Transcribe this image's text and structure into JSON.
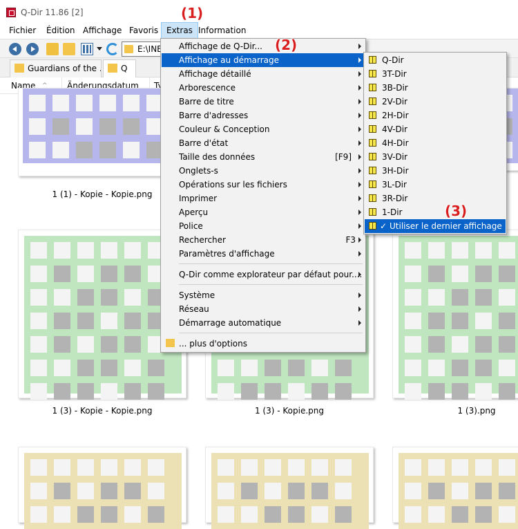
{
  "window": {
    "title": "Q-Dir 11.86 [2]"
  },
  "menubar": {
    "items": [
      "Fichier",
      "Édition",
      "Affichage",
      "Favoris",
      "Extras",
      "Information"
    ]
  },
  "toolbar": {
    "address": "E:\\INE"
  },
  "tabs": [
    "Guardians of the ...",
    "Q"
  ],
  "columns": {
    "name": "Name",
    "date": "Änderungsdatum",
    "type": "Ty"
  },
  "files": {
    "row1": [
      "1 (1) - Kopie - Kopie.png"
    ],
    "row2": [
      "1 (3) - Kopie - Kopie.png",
      "1 (3) - Kopie.png",
      "1 (3).png"
    ]
  },
  "extras_menu": {
    "items": [
      {
        "label": "Affichage de Q-Dir...",
        "shortcut": "",
        "submenu": true
      },
      {
        "label": "Affichage au démarrage",
        "shortcut": "",
        "submenu": true,
        "highlighted": true
      },
      {
        "label": "Affichage détaillé",
        "shortcut": "",
        "submenu": true
      },
      {
        "label": "Arborescence",
        "shortcut": "",
        "submenu": true
      },
      {
        "label": "Barre de titre",
        "shortcut": "",
        "submenu": true
      },
      {
        "label": "Barre d'adresses",
        "shortcut": "",
        "submenu": true
      },
      {
        "label": "Couleur & Conception",
        "shortcut": "",
        "submenu": true
      },
      {
        "label": "Barre d'état",
        "shortcut": "",
        "submenu": true
      },
      {
        "label": "Taille des données",
        "shortcut": "[F9]",
        "submenu": true
      },
      {
        "label": "Onglets-s",
        "shortcut": "",
        "submenu": true
      },
      {
        "label": "Opérations sur les fichiers",
        "shortcut": "",
        "submenu": true
      },
      {
        "label": "Imprimer",
        "shortcut": "",
        "submenu": true
      },
      {
        "label": "Aperçu",
        "shortcut": "",
        "submenu": true
      },
      {
        "label": "Police",
        "shortcut": "",
        "submenu": true
      },
      {
        "label": "Rechercher",
        "shortcut": "F3",
        "submenu": true
      },
      {
        "label": "Paramètres d'affichage",
        "shortcut": "",
        "submenu": true
      },
      {
        "label": "Q-Dir comme explorateur par défaut pour....",
        "shortcut": "",
        "submenu": true
      },
      {
        "label": "Système",
        "shortcut": "",
        "submenu": true
      },
      {
        "label": "Réseau",
        "shortcut": "",
        "submenu": true
      },
      {
        "label": "Démarrage automatique",
        "shortcut": "",
        "submenu": true
      },
      {
        "label": "... plus d'options",
        "shortcut": "",
        "submenu": false
      }
    ]
  },
  "startup_submenu": {
    "items": [
      {
        "label": "Q-Dir",
        "icon": "layout-4-icon"
      },
      {
        "label": "3T-Dir",
        "icon": "layout-3t-icon"
      },
      {
        "label": "3B-Dir",
        "icon": "layout-3b-icon"
      },
      {
        "label": "2V-Dir",
        "icon": "layout-2v-icon"
      },
      {
        "label": "2H-Dir",
        "icon": "layout-2h-icon"
      },
      {
        "label": "4V-Dir",
        "icon": "layout-4v-icon"
      },
      {
        "label": "4H-Dir",
        "icon": "layout-4h-icon"
      },
      {
        "label": "3V-Dir",
        "icon": "layout-3v-icon"
      },
      {
        "label": "3H-Dir",
        "icon": "layout-3h-icon"
      },
      {
        "label": "3L-Dir",
        "icon": "layout-3l-icon"
      },
      {
        "label": "3R-Dir",
        "icon": "layout-3r-icon"
      },
      {
        "label": "1-Dir",
        "icon": "layout-1-icon"
      },
      {
        "label": "Utiliser le dernier affichage",
        "icon": "star-layout-icon",
        "checked": "✓",
        "highlighted": true
      }
    ]
  },
  "annotations": [
    "(1)",
    "(2)",
    "(3)"
  ],
  "colors": {
    "highlight": "#0a63c9",
    "annotation": "#d81e1e",
    "thumb_purple": "#b6b6ec",
    "thumb_green": "#bfe6bf",
    "thumb_tan": "#ebe1b4",
    "cell_gray": "#b3b3b3"
  }
}
